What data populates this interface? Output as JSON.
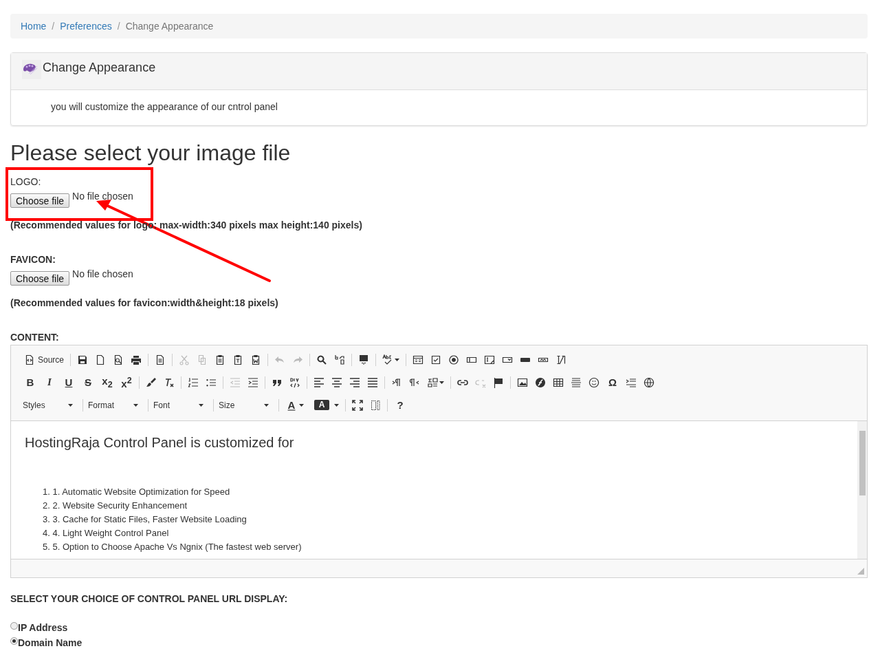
{
  "breadcrumb": [
    {
      "kind": "link",
      "label": "Home"
    },
    {
      "kind": "separator",
      "label": "/"
    },
    {
      "kind": "link",
      "label": "Preferences"
    },
    {
      "kind": "separator",
      "label": "/"
    },
    {
      "kind": "current",
      "label": "Change Appearance"
    }
  ],
  "panel": {
    "title": "Change Appearance",
    "text": "you will customize the appearance of our cntrol panel"
  },
  "heading": "Please select your image file",
  "uploads": [
    {
      "label": "LOGO:",
      "bold": false,
      "button": "Choose file",
      "status": "No file chosen",
      "note": "(Recommended values for logo: max-width:340 pixels max height:140 pixels)"
    },
    {
      "label": "FAVICON:",
      "bold": true,
      "button": "Choose file",
      "status": "No file chosen",
      "note": "(Recommended values for favicon:width&height:18 pixels)"
    }
  ],
  "content_label": "CONTENT:",
  "toolbar": [
    [
      [
        {
          "kind": "source",
          "label": "Source"
        }
      ],
      [
        {
          "kind": "icon"
        },
        {
          "kind": "icon"
        },
        {
          "kind": "icon"
        },
        {
          "kind": "icon"
        }
      ],
      [
        {
          "kind": "icon"
        }
      ],
      [
        {
          "kind": "icon",
          "disabled": true
        },
        {
          "kind": "icon",
          "disabled": true
        },
        {
          "kind": "icon"
        },
        {
          "kind": "icon"
        },
        {
          "kind": "icon"
        }
      ],
      [
        {
          "kind": "icon",
          "disabled": true
        },
        {
          "kind": "icon",
          "disabled": true
        }
      ],
      [
        {
          "kind": "icon"
        },
        {
          "kind": "icon"
        }
      ],
      [
        {
          "kind": "icon"
        }
      ],
      [
        {
          "kind": "icon-menu"
        }
      ],
      [
        {
          "kind": "icon"
        },
        {
          "kind": "icon"
        },
        {
          "kind": "icon"
        },
        {
          "kind": "icon"
        },
        {
          "kind": "icon"
        },
        {
          "kind": "icon"
        },
        {
          "kind": "icon"
        },
        {
          "kind": "icon"
        },
        {
          "kind": "icon"
        }
      ]
    ],
    [
      [
        {
          "kind": "glyph",
          "label": "B"
        },
        {
          "kind": "glyph",
          "label": "I"
        },
        {
          "kind": "glyph",
          "label": "U"
        },
        {
          "kind": "glyph",
          "label": "S"
        },
        {
          "kind": "glyph",
          "label": "x$_{2}$"
        },
        {
          "kind": "glyph",
          "label": "x$^{2}$"
        }
      ],
      [
        {
          "kind": "icon"
        },
        {
          "kind": "icon"
        }
      ],
      [
        {
          "kind": "icon"
        },
        {
          "kind": "icon"
        }
      ],
      [
        {
          "kind": "icon",
          "disabled": true
        },
        {
          "kind": "icon"
        }
      ],
      [
        {
          "kind": "icon"
        },
        {
          "kind": "icon"
        }
      ],
      [
        {
          "kind": "icon"
        },
        {
          "kind": "icon"
        },
        {
          "kind": "icon"
        },
        {
          "kind": "icon"
        }
      ],
      [
        {
          "kind": "icon"
        },
        {
          "kind": "icon"
        },
        {
          "kind": "icon-menu"
        }
      ],
      [
        {
          "kind": "icon"
        },
        {
          "kind": "icon",
          "disabled": true
        },
        {
          "kind": "icon"
        }
      ],
      [
        {
          "kind": "icon"
        },
        {
          "kind": "icon"
        },
        {
          "kind": "icon"
        },
        {
          "kind": "icon"
        },
        {
          "kind": "icon"
        },
        {
          "kind": "glyph",
          "label": "Ω"
        },
        {
          "kind": "icon"
        },
        {
          "kind": "icon"
        }
      ]
    ],
    [
      [
        {
          "kind": "combo",
          "label": "Styles"
        }
      ],
      [
        {
          "kind": "combo",
          "label": "Format"
        }
      ],
      [
        {
          "kind": "combo",
          "label": "Font"
        }
      ],
      [
        {
          "kind": "combo",
          "label": "Size"
        }
      ],
      [
        {
          "kind": "glyph-menu",
          "label": "A"
        },
        {
          "kind": "glyph-menu",
          "label": "A"
        }
      ],
      [
        {
          "kind": "icon"
        },
        {
          "kind": "icon"
        }
      ],
      [
        {
          "kind": "glyph",
          "label": "?"
        }
      ]
    ]
  ],
  "editor": {
    "title": "HostingRaja Control Panel is customized for",
    "items": [
      "1. 1. Automatic Website Optimization for Speed",
      "2. 2. Website Security Enhancement",
      "3. 3. Cache for Static Files, Faster Website Loading",
      "4. 4. Light Weight Control Panel",
      "5. 5. Option to Choose Apache Vs Ngnix (The fastest web server)"
    ]
  },
  "url_display": {
    "label": "SELECT YOUR CHOICE OF CONTROL PANEL URL DISPLAY:",
    "options": [
      {
        "label": "IP Address",
        "selected": false
      },
      {
        "label": "Domain Name",
        "selected": true
      }
    ]
  }
}
